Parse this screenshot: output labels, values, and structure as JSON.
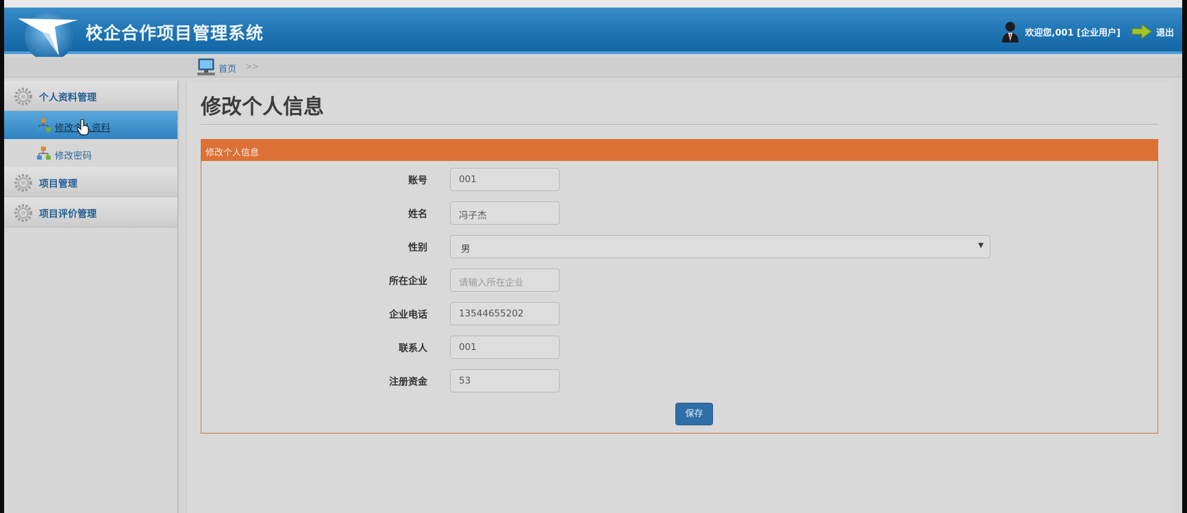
{
  "header": {
    "title": "校企合作项目管理系统",
    "welcome": "欢迎您,001 [企业用户]",
    "logout": "退出"
  },
  "breadcrumb": {
    "home": "首页",
    "separator": ">>"
  },
  "sidebar": {
    "groups": [
      {
        "label": "个人资料管理",
        "items": [
          {
            "label": "修改个人资料",
            "active": true
          },
          {
            "label": "修改密码",
            "active": false
          }
        ]
      },
      {
        "label": "项目管理"
      },
      {
        "label": "项目评价管理"
      }
    ]
  },
  "main": {
    "page_title": "修改个人信息",
    "panel_title": "修改个人信息",
    "form": {
      "account": {
        "label": "账号",
        "value": "001"
      },
      "name": {
        "label": "姓名",
        "value": "冯子杰"
      },
      "gender": {
        "label": "性别",
        "value": "男"
      },
      "company": {
        "label": "所在企业",
        "value": "",
        "placeholder": "请输入所在企业"
      },
      "phone": {
        "label": "企业电话",
        "value": "13544655202"
      },
      "contact": {
        "label": "联系人",
        "value": "001"
      },
      "capital": {
        "label": "注册资金",
        "value": "53"
      }
    },
    "save_label": "保存"
  },
  "colors": {
    "header_blue": "#2378b7",
    "panel_orange": "#dc7035",
    "button_blue": "#2f6ea6",
    "link_blue": "#245f93"
  },
  "icons": [
    "logo-plane-icon",
    "user-avatar-icon",
    "exit-arrow-icon",
    "computer-icon",
    "gear-icon",
    "tree-node-icon",
    "hand-cursor-icon"
  ]
}
